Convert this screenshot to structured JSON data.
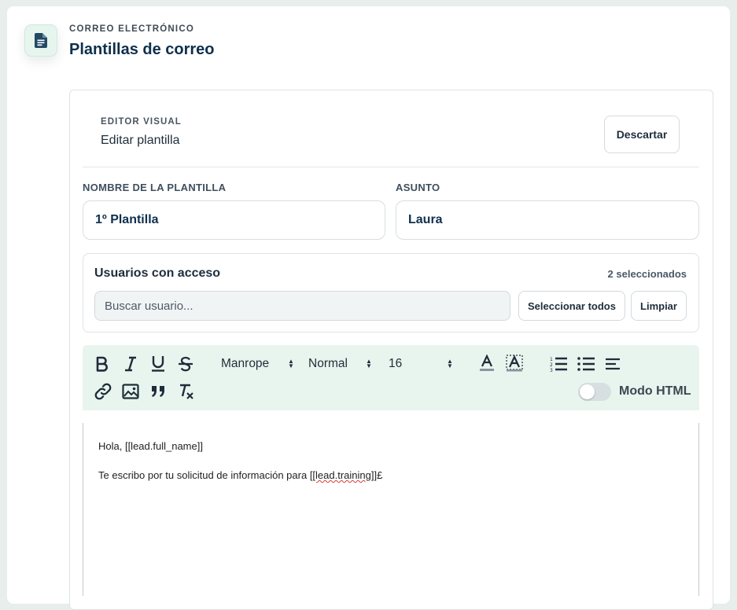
{
  "header": {
    "eyebrow": "CORREO ELECTRÓNICO",
    "title": "Plantillas de correo",
    "icon": "document-icon"
  },
  "editor": {
    "eyebrow": "EDITOR VISUAL",
    "title": "Editar plantilla",
    "discard_label": "Descartar"
  },
  "fields": {
    "name_label": "NOMBRE DE LA PLANTILLA",
    "name_value": "1º Plantilla",
    "subject_label": "ASUNTO",
    "subject_value": "Laura"
  },
  "access": {
    "title": "Usuarios con acceso",
    "count": "2 seleccionados",
    "search_placeholder": "Buscar usuario...",
    "select_all_label": "Seleccionar todos",
    "clear_label": "Limpiar"
  },
  "toolbar": {
    "font": "Manrope",
    "style": "Normal",
    "size": "16",
    "html_mode_label": "Modo HTML",
    "html_mode_on": false
  },
  "content": {
    "line1": "Hola, [[lead.full_name]]",
    "line2_prefix": "Te escribo por tu solicitud de información para ",
    "line2_var": "[[lead.training]]",
    "line2_suffix": "£"
  },
  "colors": {
    "accent": "#e8f5ee",
    "title": "#0f2f4c",
    "background": "#e7eeec"
  }
}
